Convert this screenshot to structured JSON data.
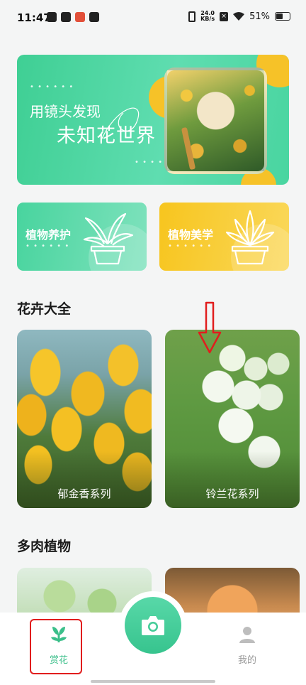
{
  "status_bar": {
    "time": "11:47",
    "net_speed_value": "24.0",
    "net_speed_unit": "KB/s",
    "battery": "51%"
  },
  "banner": {
    "line1": "用镜头发现",
    "line2": "未知花世界",
    "accent_color": "#f6c228"
  },
  "categories": [
    {
      "label": "植物养护",
      "color": "#48d49e"
    },
    {
      "label": "植物美学",
      "color": "#f7c51e"
    }
  ],
  "sections": {
    "flowers_title": "花卉大全",
    "succulents_title": "多肉植物"
  },
  "flower_cards": [
    {
      "name": "郁金香系列"
    },
    {
      "name": "铃兰花系列"
    }
  ],
  "tabbar": {
    "flower_label": "赏花",
    "mine_label": "我的",
    "active_color": "#3bbf8a"
  }
}
